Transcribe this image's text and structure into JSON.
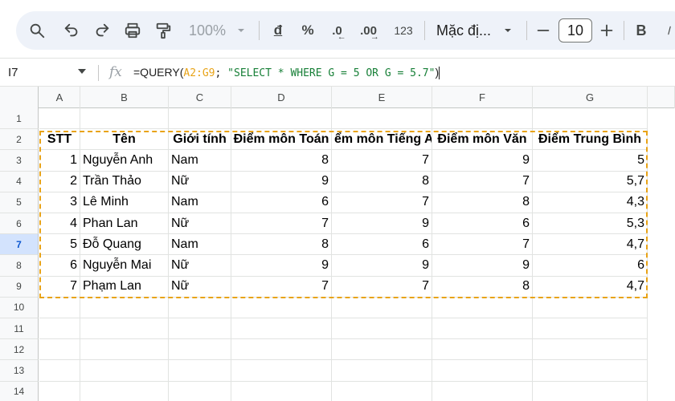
{
  "toolbar": {
    "zoom": "100%",
    "currency": "đ",
    "percent": "%",
    "dec_decrease": ".0",
    "dec_increase": ".00",
    "number_format": "123",
    "font_name": "Mặc đị...",
    "font_size": "10",
    "bold": "B",
    "icons": [
      "search-icon",
      "undo-icon",
      "redo-icon",
      "print-icon",
      "paint-format-icon",
      "chevron-down-icon",
      "minus-icon",
      "plus-icon",
      "bold-icon"
    ]
  },
  "formula_bar": {
    "cell_ref": "I7",
    "fx": "fx",
    "formula_prefix": "=QUERY(",
    "formula_range": "A2:G9",
    "formula_sep": "; ",
    "formula_string": "\"SELECT * WHERE G = 5 OR G = 5.7\"",
    "formula_suffix": ")"
  },
  "columns": [
    "A",
    "B",
    "C",
    "D",
    "E",
    "F",
    "G"
  ],
  "rows": [
    "1",
    "2",
    "3",
    "4",
    "5",
    "6",
    "7",
    "8",
    "9",
    "10",
    "11",
    "12",
    "13",
    "14"
  ],
  "selected_row": "7",
  "table": {
    "headers": [
      "STT",
      "Tên",
      "Giới tính",
      "Điểm môn Toán",
      "ểm môn Tiếng A",
      "Điểm môn Văn",
      "Điểm Trung Bình"
    ],
    "data": [
      [
        "1",
        "Nguyễn Anh",
        "Nam",
        "8",
        "7",
        "9",
        "5"
      ],
      [
        "2",
        "Trần Thảo",
        "Nữ",
        "9",
        "8",
        "7",
        "5,7"
      ],
      [
        "3",
        "Lê Minh",
        "Nam",
        "6",
        "7",
        "8",
        "4,3"
      ],
      [
        "4",
        "Phan Lan",
        "Nữ",
        "7",
        "9",
        "6",
        "5,3"
      ],
      [
        "5",
        "Đỗ Quang",
        "Nam",
        "8",
        "6",
        "7",
        "4,7"
      ],
      [
        "6",
        "Nguyễn Mai",
        "Nữ",
        "9",
        "9",
        "9",
        "6"
      ],
      [
        "7",
        "Phạm Lan",
        "Nữ",
        "7",
        "7",
        "8",
        "4,7"
      ]
    ]
  },
  "colors": {
    "selection_outline": "#e8a317",
    "range_highlight": "#e8a317",
    "string_literal": "#188038",
    "selected_row_bg": "#d3e3fd"
  }
}
